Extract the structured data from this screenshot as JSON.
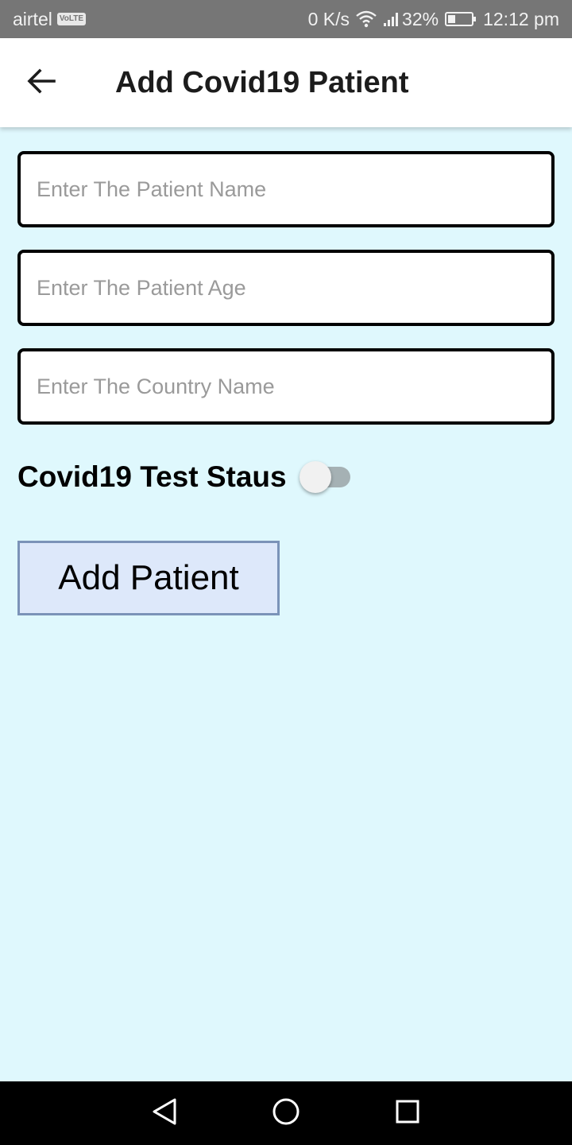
{
  "status_bar": {
    "carrier": "airtel",
    "volte": "VoLTE",
    "network_speed": "0 K/s",
    "battery_percent": "32%",
    "battery_level": 0.32,
    "time": "12:12 pm",
    "icons": [
      "wifi-icon",
      "signal-icon",
      "battery-icon"
    ]
  },
  "app_bar": {
    "title": "Add Covid19 Patient",
    "back_icon": "arrow-left-icon"
  },
  "form": {
    "patient_name": {
      "value": "",
      "placeholder": "Enter The Patient Name"
    },
    "patient_age": {
      "value": "",
      "placeholder": "Enter The Patient Age"
    },
    "country_name": {
      "value": "",
      "placeholder": "Enter The Country Name"
    },
    "test_status_label": "Covid19 Test Staus",
    "test_status_on": false,
    "submit_label": "Add Patient"
  },
  "nav_bar": {
    "icons": [
      "back-triangle-icon",
      "home-circle-icon",
      "recents-square-icon"
    ]
  },
  "colors": {
    "background": "#dff8fd",
    "status_bar": "#767676",
    "button_bg": "#dde8fa",
    "button_border": "#7b93b8",
    "toggle_track": "#a5b1b4"
  }
}
